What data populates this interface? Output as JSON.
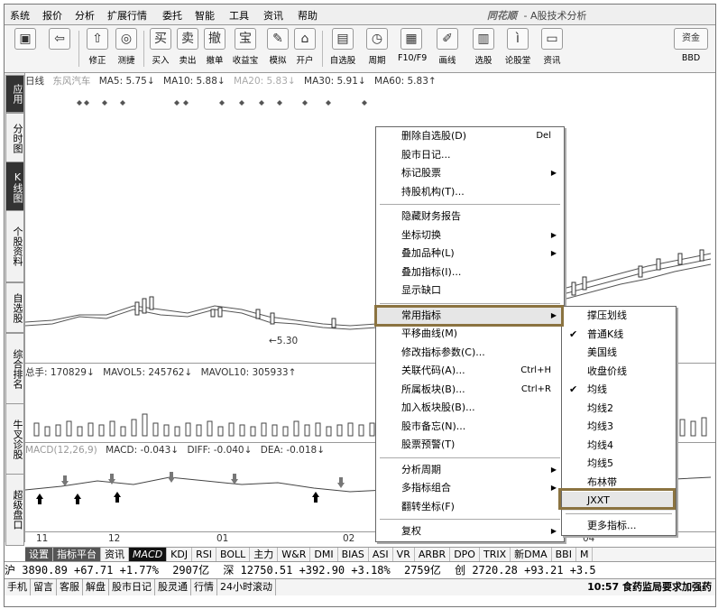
{
  "menubar": {
    "items": [
      "系统",
      "报价",
      "分析",
      "扩展行情",
      "委托",
      "智能",
      "工具",
      "资讯",
      "帮助"
    ],
    "app_logo": "同花顺",
    "app_title": "- A股技术分析"
  },
  "toolbar": {
    "buttons": [
      {
        "icon": "▣",
        "label": ""
      },
      {
        "icon": "⇦",
        "label": ""
      },
      {
        "icon": "⇧",
        "label": "修正"
      },
      {
        "icon": "◎",
        "label": "测捷"
      },
      {
        "icon": "买",
        "label": "买入"
      },
      {
        "icon": "卖",
        "label": "卖出"
      },
      {
        "icon": "撤",
        "label": "撤单"
      },
      {
        "icon": "宝",
        "label": "收益宝"
      },
      {
        "icon": "✎",
        "label": "模拟"
      },
      {
        "icon": "⌂",
        "label": "开户"
      },
      {
        "icon": "▤",
        "label": "自选股"
      },
      {
        "icon": "◷",
        "label": "周期"
      },
      {
        "icon": "▦",
        "label": "F10/F9"
      },
      {
        "icon": "✐",
        "label": "画线"
      },
      {
        "icon": "▥",
        "label": "选股"
      },
      {
        "icon": "ì",
        "label": "论股堂"
      },
      {
        "icon": "▭",
        "label": "资讯"
      },
      {
        "icon": "资金",
        "label": "BBD"
      }
    ]
  },
  "left_tabs": [
    "应用",
    "分时图",
    "K线图",
    "个股资料",
    "自选股",
    "综合排名",
    "牛叉诊股",
    "超级盘口"
  ],
  "chart": {
    "ma_bar": {
      "period": "日线",
      "stock": "东风汽车",
      "ma5": "MA5: 5.75↓",
      "ma10": "MA10: 5.88↓",
      "ma20": "MA20: 5.83↓",
      "ma30": "MA30: 5.91↓",
      "ma60": "MA60: 5.83↑"
    },
    "low_label": "←5.30",
    "vol_bar": {
      "total": "总手: 170829↓",
      "mavol5": "MAVOL5: 245762↓",
      "mavol10": "MAVOL10: 305933↑"
    },
    "macd_bar": {
      "name": "MACD(12,26,9)",
      "macd": "MACD: -0.043↓",
      "diff": "DIFF: -0.040↓",
      "dea": "DEA: -0.018↓"
    },
    "x_ticks": [
      "11",
      "12",
      "01",
      "02",
      "04"
    ]
  },
  "indicator_tabs": [
    "设置",
    "指标平台",
    "资讯",
    "MACD",
    "KDJ",
    "RSI",
    "BOLL",
    "主力",
    "W&R",
    "DMI",
    "BIAS",
    "ASI",
    "VR",
    "ARBR",
    "DPO",
    "TRIX",
    "新DMA",
    "BBI",
    "M"
  ],
  "status_quotes": {
    "sh": "沪 3890.89  +67.71  +1.77%",
    "sh_amt": "2907亿",
    "sz": "深 12750.51  +392.90  +3.18%",
    "sz_amt": "2759亿",
    "cy": "创 2720.28  +93.21  +3.5"
  },
  "status_bar": {
    "items": [
      "手机",
      "留言",
      "客服",
      "解盘",
      "股市日记",
      "股灵通",
      "行情",
      "24小时滚动"
    ],
    "news": "10:57 食药监局要求加强药"
  },
  "context_menu": {
    "items": [
      {
        "label": "删除自选股(D)",
        "shortcut": "Del"
      },
      {
        "label": "股市日记..."
      },
      {
        "label": "标记股票",
        "arrow": true
      },
      {
        "label": "持股机构(T)..."
      },
      {
        "sep": true
      },
      {
        "label": "隐藏财务报告"
      },
      {
        "label": "坐标切换",
        "arrow": true
      },
      {
        "label": "叠加品种(L)",
        "arrow": true
      },
      {
        "label": "叠加指标(I)..."
      },
      {
        "label": "显示缺口"
      },
      {
        "sep": true
      },
      {
        "label": "常用指标",
        "arrow": true,
        "highlight": true
      },
      {
        "label": "平移曲线(M)"
      },
      {
        "label": "修改指标参数(C)..."
      },
      {
        "label": "关联代码(A)...",
        "shortcut": "Ctrl+H"
      },
      {
        "label": "所属板块(B)...",
        "shortcut": "Ctrl+R"
      },
      {
        "label": "加入板块股(B)..."
      },
      {
        "label": "股市备忘(N)..."
      },
      {
        "label": "股票预警(T)"
      },
      {
        "sep": true
      },
      {
        "label": "分析周期",
        "arrow": true
      },
      {
        "label": "多指标组合",
        "arrow": true
      },
      {
        "label": "翻转坐标(F)"
      },
      {
        "sep": true
      },
      {
        "label": "复权",
        "arrow": true
      }
    ]
  },
  "submenu": {
    "items": [
      {
        "label": "撑压划线"
      },
      {
        "label": "普通K线",
        "checked": true
      },
      {
        "label": "美国线"
      },
      {
        "label": "收盘价线"
      },
      {
        "label": "均线",
        "checked": true
      },
      {
        "label": "均线2"
      },
      {
        "label": "均线3"
      },
      {
        "label": "均线4"
      },
      {
        "label": "均线5"
      },
      {
        "label": "布林带"
      },
      {
        "label": "JXXT",
        "highlight": true
      },
      {
        "sep": true
      },
      {
        "label": "更多指标..."
      }
    ]
  }
}
